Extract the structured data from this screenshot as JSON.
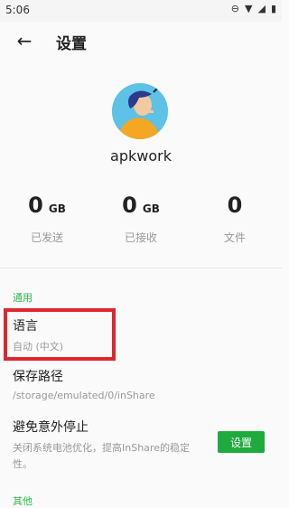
{
  "status_bar": {
    "time": "5:06",
    "icons": [
      "do-not-disturb-icon",
      "wifi-icon",
      "signal-icon",
      "battery-icon"
    ]
  },
  "header": {
    "title": "设置"
  },
  "profile": {
    "username": "apkwork"
  },
  "stats": [
    {
      "value": "0",
      "unit": "GB",
      "label": "已发送"
    },
    {
      "value": "0",
      "unit": "GB",
      "label": "已接收"
    },
    {
      "value": "0",
      "unit": "",
      "label": "文件"
    }
  ],
  "general": {
    "section_label": "通用",
    "language": {
      "title": "语言",
      "value": "自动 (中文)"
    },
    "save_path": {
      "title": "保存路径",
      "value": "/storage/emulated/0/inShare"
    },
    "avoid_stop": {
      "title": "避免意外停止",
      "desc_line1": "关闭系统电池优化，提高InShare的稳定",
      "desc_line2": "性。",
      "button_label": "设置"
    }
  },
  "other": {
    "section_label": "其他"
  },
  "colors": {
    "accent": "#2db84d",
    "button": "#1faa3e",
    "highlight": "#e0262f"
  }
}
